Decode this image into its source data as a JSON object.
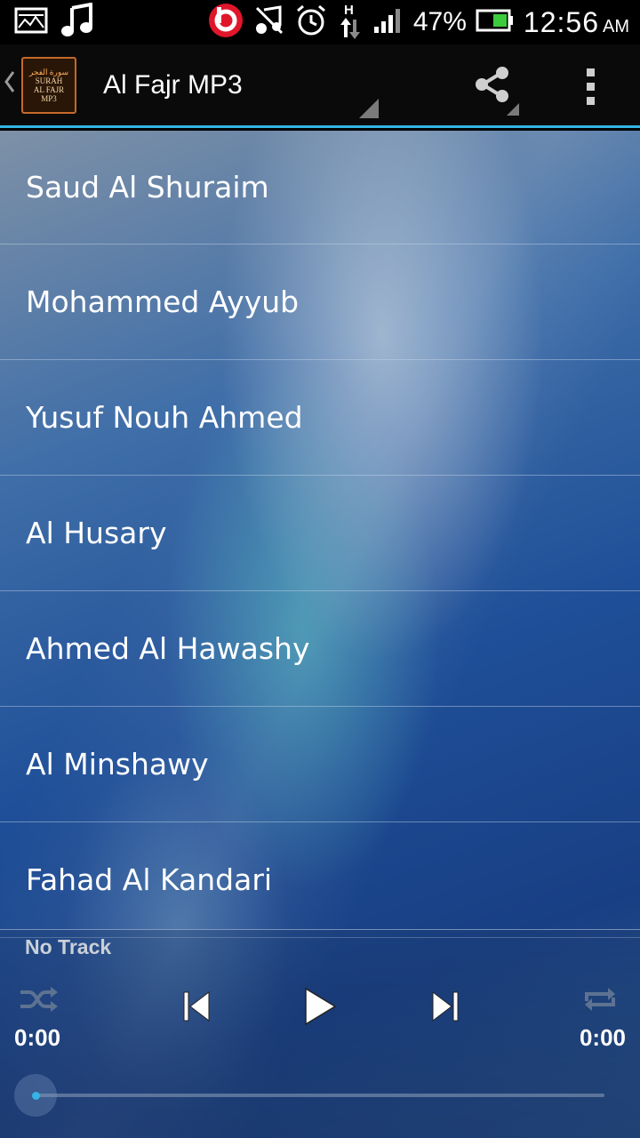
{
  "status_bar": {
    "icons": [
      "image-icon",
      "music-note-icon",
      "beats-audio-icon",
      "mute-icon",
      "alarm-icon",
      "hspa-data-icon",
      "signal-icon",
      "battery-icon"
    ],
    "battery": "47%",
    "time": "12:56",
    "ampm": "AM",
    "accent": "#33b5e5"
  },
  "action_bar": {
    "logo": {
      "line1": "سورة الفجر",
      "line2": "SURAH",
      "line3": "AL FAJR",
      "line4": "MP3"
    },
    "title": "Al Fajr MP3",
    "icons": [
      "share-icon",
      "overflow-menu-icon"
    ]
  },
  "reciters": [
    "Saud Al Shuraim",
    "Mohammed Ayyub",
    "Yusuf Nouh Ahmed",
    "Al Husary",
    "Ahmed Al Hawashy",
    "Al Minshawy",
    "Fahad Al Kandari"
  ],
  "player": {
    "track": "No Track",
    "elapsed": "0:00",
    "duration": "0:00",
    "progress": 0.0,
    "controls": [
      "shuffle-icon",
      "previous-icon",
      "play-icon",
      "next-icon",
      "repeat-icon"
    ]
  }
}
